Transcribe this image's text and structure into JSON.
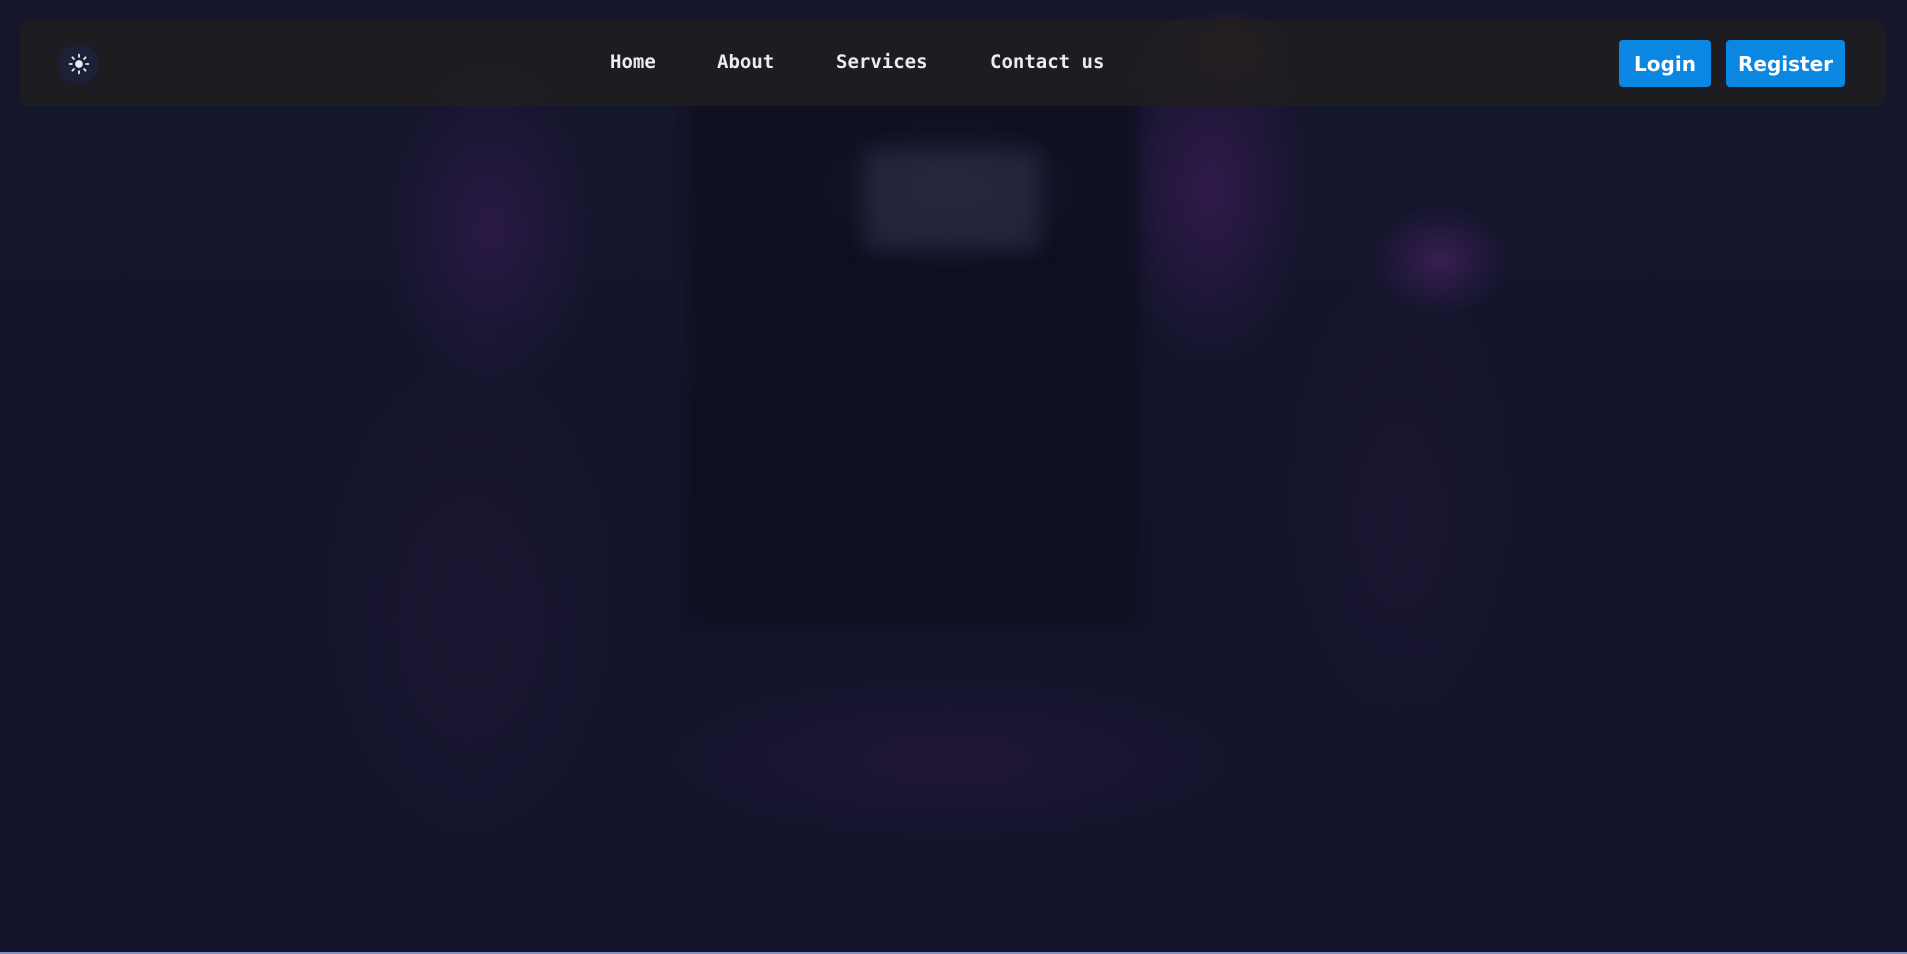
{
  "theme_toggle": {
    "icon": "sun-icon"
  },
  "nav": {
    "items": [
      {
        "label": "Home"
      },
      {
        "label": "About"
      },
      {
        "label": "Services"
      },
      {
        "label": "Contact us"
      }
    ]
  },
  "auth": {
    "login_label": "Login",
    "register_label": "Register"
  },
  "colors": {
    "accent": "#0a86e3",
    "navbar_bg": "#201e1e",
    "page_bg": "#11142a"
  }
}
